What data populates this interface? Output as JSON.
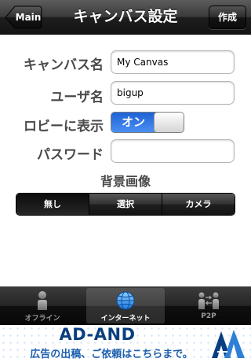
{
  "navbar": {
    "title": "キャンバス設定",
    "back_label": "Main",
    "create_label": "作成"
  },
  "form": {
    "canvas_name_label": "キャンバス名",
    "canvas_name_value": "My Canvas",
    "user_name_label": "ユーザ名",
    "user_name_value": "bigup",
    "lobby_label": "ロビーに表示",
    "lobby_toggle_label": "オン",
    "lobby_toggle_on": true,
    "password_label": "パスワード",
    "password_value": ""
  },
  "background": {
    "title": "背景画像",
    "options": [
      "無し",
      "選択",
      "カメラ"
    ],
    "selected": "無し"
  },
  "tabbar": {
    "tabs": [
      {
        "label": "オフライン",
        "icon": "person-icon"
      },
      {
        "label": "インターネット",
        "icon": "globe-icon"
      },
      {
        "label": "P2P",
        "icon": "p2p-icon"
      }
    ],
    "selected": "インターネット"
  },
  "ad": {
    "title": "AD-AND",
    "subtitle": "広告の出稿、ご依頼はこちらまで。",
    "logo_icon": "ad-and-logo-icon"
  },
  "colors": {
    "toggle_on": "#3a7ee8",
    "ad_text": "#0a3f7f"
  }
}
